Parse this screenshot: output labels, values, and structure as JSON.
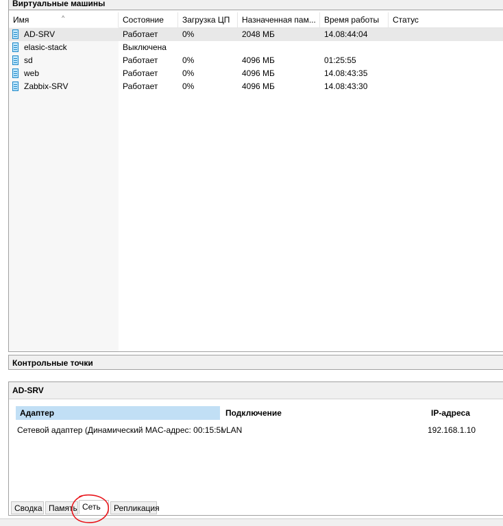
{
  "vm_panel": {
    "title": "Виртуальные машины",
    "columns": [
      "Имя",
      "Состояние",
      "Загрузка ЦП",
      "Назначенная пам...",
      "Время работы",
      "Статус"
    ],
    "rows": [
      {
        "name": "AD-SRV",
        "state": "Работает",
        "cpu": "0%",
        "memory": "2048 МБ",
        "uptime": "14.08:44:04",
        "status": ""
      },
      {
        "name": "elasic-stack",
        "state": "Выключена",
        "cpu": "",
        "memory": "",
        "uptime": "",
        "status": ""
      },
      {
        "name": "sd",
        "state": "Работает",
        "cpu": "0%",
        "memory": "4096 МБ",
        "uptime": "01:25:55",
        "status": ""
      },
      {
        "name": "web",
        "state": "Работает",
        "cpu": "0%",
        "memory": "4096 МБ",
        "uptime": "14.08:43:35",
        "status": ""
      },
      {
        "name": "Zabbix-SRV",
        "state": "Работает",
        "cpu": "0%",
        "memory": "4096 МБ",
        "uptime": "14.08:43:30",
        "status": ""
      }
    ],
    "icon": "vm-icon",
    "sort_icon": "sort-ascending-icon"
  },
  "checkpoints_panel": {
    "title": "Контрольные точки"
  },
  "details_panel": {
    "title": "AD-SRV",
    "network": {
      "columns": [
        "Адаптер",
        "Подключение",
        "IP-адреса"
      ],
      "row": {
        "adapter": "Сетевой адаптер (Динамический MAC-адрес: 00:15:5D:...",
        "connection": "vLAN",
        "ip": "192.168.1.10"
      }
    },
    "tabs": [
      "Сводка",
      "Память",
      "Сеть",
      "Репликация"
    ],
    "active_tab": "Сеть"
  },
  "colors": {
    "selection_header": "#c1dff5",
    "annotation": "#e8141a",
    "vm_icon": "#1a86c8"
  }
}
